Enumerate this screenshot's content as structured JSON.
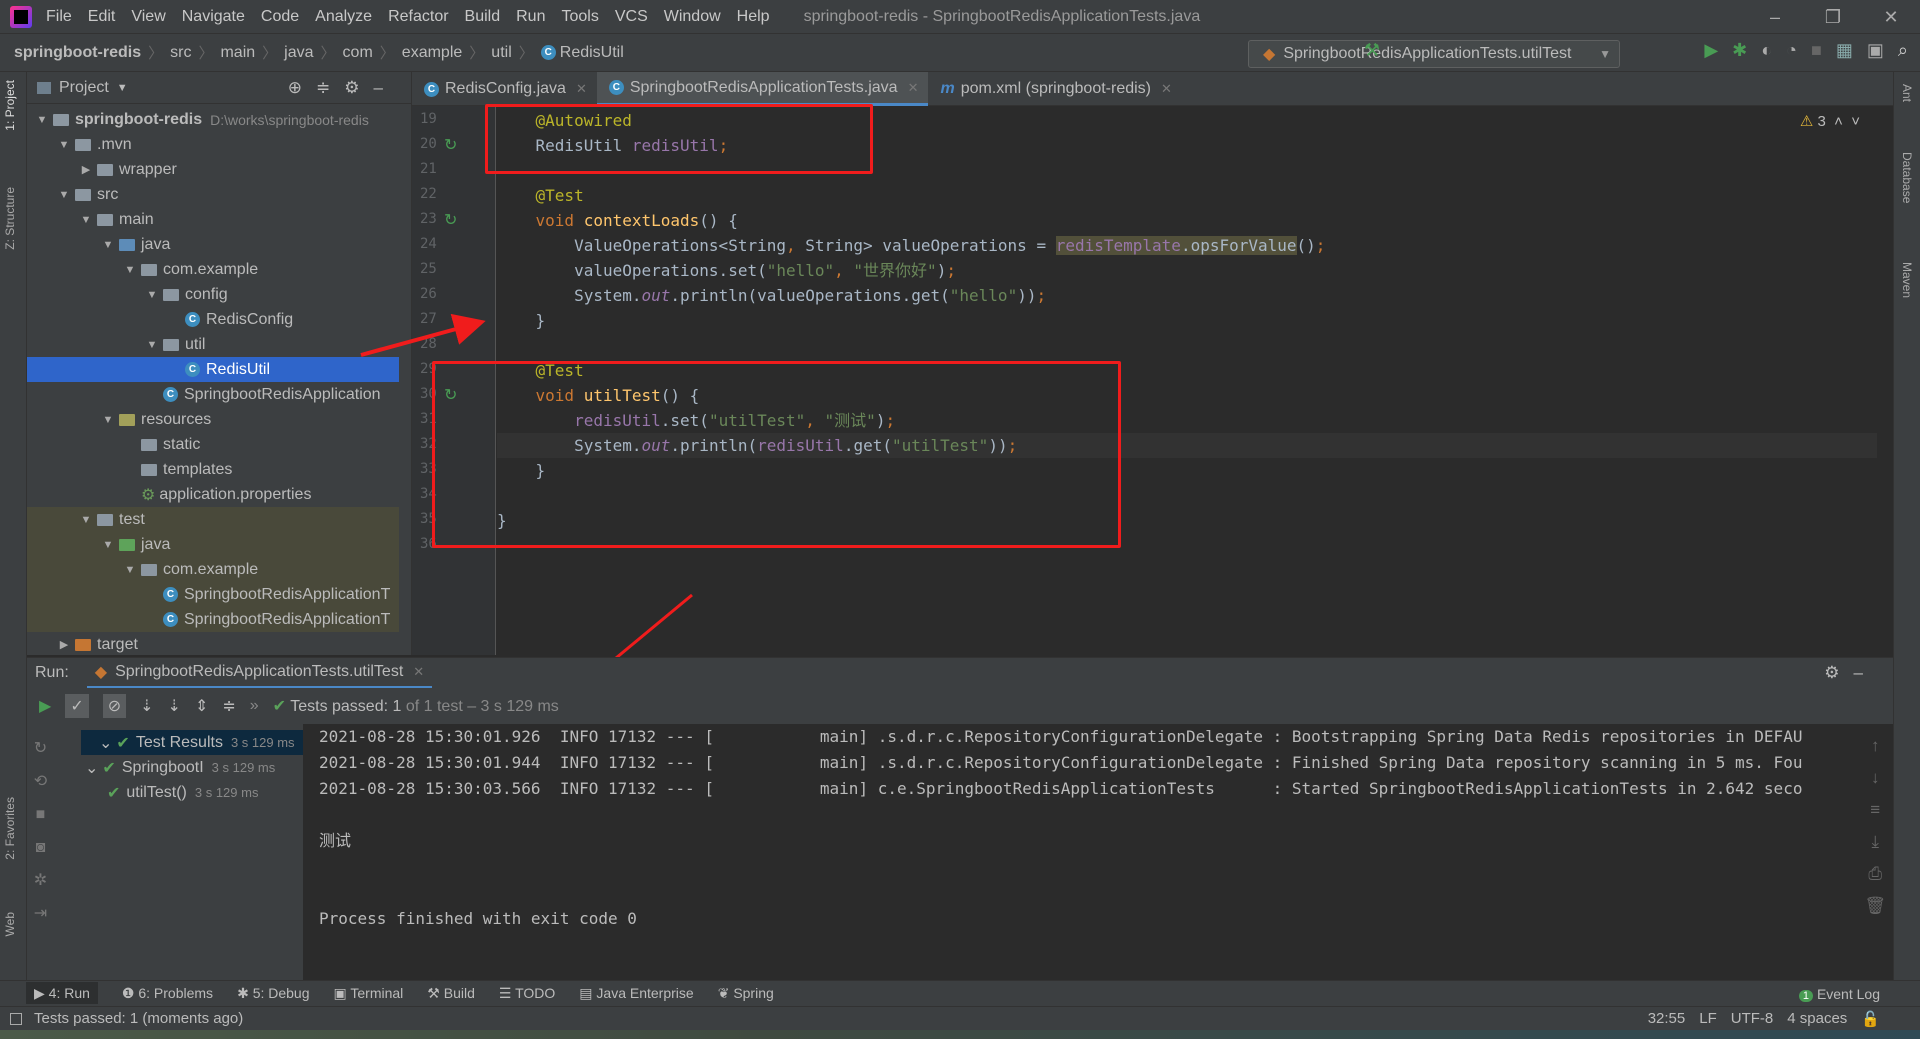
{
  "menubar": {
    "items": [
      "File",
      "Edit",
      "View",
      "Navigate",
      "Code",
      "Analyze",
      "Refactor",
      "Build",
      "Run",
      "Tools",
      "VCS",
      "Window",
      "Help"
    ],
    "title": "springboot-redis - SpringbootRedisApplicationTests.java"
  },
  "breadcrumb": [
    "springboot-redis",
    "src",
    "main",
    "java",
    "com",
    "example",
    "util",
    "RedisUtil"
  ],
  "run_config": "SpringbootRedisApplicationTests.utilTest",
  "left_strip": [
    "1: Project",
    "Z: Structure",
    "2: Favorites",
    "Web"
  ],
  "right_strip": [
    "Ant",
    "Database",
    "Maven"
  ],
  "project": {
    "title": "Project",
    "tree": [
      {
        "label": "springboot-redis",
        "hint": "D:\\works\\springboot-redis",
        "depth": 0,
        "open": true,
        "kind": "module"
      },
      {
        "label": ".mvn",
        "depth": 1,
        "open": true,
        "kind": "folder"
      },
      {
        "label": "wrapper",
        "depth": 2,
        "open": false,
        "kind": "folder"
      },
      {
        "label": "src",
        "depth": 1,
        "open": true,
        "kind": "folder"
      },
      {
        "label": "main",
        "depth": 2,
        "open": true,
        "kind": "folder"
      },
      {
        "label": "java",
        "depth": 3,
        "open": true,
        "kind": "src"
      },
      {
        "label": "com.example",
        "depth": 4,
        "open": true,
        "kind": "folder"
      },
      {
        "label": "config",
        "depth": 5,
        "open": true,
        "kind": "folder"
      },
      {
        "label": "RedisConfig",
        "depth": 6,
        "kind": "class"
      },
      {
        "label": "util",
        "depth": 5,
        "open": true,
        "kind": "folder"
      },
      {
        "label": "RedisUtil",
        "depth": 6,
        "kind": "class",
        "selected": true
      },
      {
        "label": "SpringbootRedisApplication",
        "depth": 5,
        "kind": "class"
      },
      {
        "label": "resources",
        "depth": 3,
        "open": true,
        "kind": "res"
      },
      {
        "label": "static",
        "depth": 4,
        "kind": "folder"
      },
      {
        "label": "templates",
        "depth": 4,
        "kind": "folder"
      },
      {
        "label": "application.properties",
        "depth": 4,
        "kind": "props"
      },
      {
        "label": "test",
        "depth": 2,
        "open": true,
        "kind": "folder",
        "test": true
      },
      {
        "label": "java",
        "depth": 3,
        "open": true,
        "kind": "tst",
        "test": true
      },
      {
        "label": "com.example",
        "depth": 4,
        "open": true,
        "kind": "folder",
        "test": true
      },
      {
        "label": "SpringbootRedisApplicationT",
        "depth": 5,
        "kind": "class",
        "test": true
      },
      {
        "label": "SpringbootRedisApplicationT",
        "depth": 5,
        "kind": "class",
        "test": true
      },
      {
        "label": "target",
        "depth": 1,
        "open": false,
        "kind": "ex"
      }
    ]
  },
  "tabs": [
    {
      "label": "RedisConfig.java",
      "icon": "class"
    },
    {
      "label": "SpringbootRedisApplicationTests.java",
      "icon": "class",
      "active": true
    },
    {
      "label": "pom.xml (springboot-redis)",
      "icon": "maven"
    }
  ],
  "editor": {
    "warnings": "3",
    "current_line": 32,
    "lines": [
      {
        "n": "19",
        "html": "    <span class='ann'>@Autowired</span>"
      },
      {
        "n": "20",
        "html": "    RedisUtil <span class='fld'>redisUtil</span><span class='kw'>;</span>"
      },
      {
        "n": "21",
        "html": ""
      },
      {
        "n": "22",
        "html": "    <span class='ann'>@Test</span>"
      },
      {
        "n": "23",
        "html": "    <span class='kw'>void </span><span class='fn'>contextLoads</span>() {"
      },
      {
        "n": "24",
        "html": "        ValueOperations&lt;String<span class='kw'>, </span>String&gt; valueOperations = <span class='hl'><span class='fld'>redisTemplate</span>.opsForValue</span>()<span class='kw'>;</span>"
      },
      {
        "n": "25",
        "html": "        valueOperations.set(<span class='str'>\"hello\"</span><span class='kw'>, </span><span class='str'>\"世界你好\"</span>)<span class='kw'>;</span>"
      },
      {
        "n": "26",
        "html": "        System.<span class='it'>out</span>.println(valueOperations.get(<span class='str'>\"hello\"</span>))<span class='kw'>;</span>"
      },
      {
        "n": "27",
        "html": "    }"
      },
      {
        "n": "28",
        "html": ""
      },
      {
        "n": "29",
        "html": "    <span class='ann'>@Test</span>"
      },
      {
        "n": "30",
        "html": "    <span class='kw'>void </span><span class='fn'>utilTest</span>() {"
      },
      {
        "n": "31",
        "html": "        <span class='fld'>redisUtil</span>.set(<span class='str'>\"utilTest\"</span><span class='kw'>, </span><span class='str'>\"测试\"</span>)<span class='kw'>;</span>"
      },
      {
        "n": "32",
        "html": "        System.<span class='it'>out</span>.println(<span class='fld'>redisUtil</span>.get(<span class='str'>\"utilTest\"</span>))<span class='kw'>;</span>"
      },
      {
        "n": "33",
        "html": "    }"
      },
      {
        "n": "34",
        "html": ""
      },
      {
        "n": "35",
        "html": "}"
      },
      {
        "n": "36",
        "html": ""
      }
    ]
  },
  "run": {
    "label": "Run:",
    "tab": "SpringbootRedisApplicationTests.utilTest",
    "status_passed": "Tests passed: 1",
    "status_rest": " of 1 test – 3 s 129 ms",
    "tree": [
      {
        "label": "Test Results",
        "time": "3 s 129 ms",
        "depth": 0
      },
      {
        "label": "SpringbootI",
        "time": "3 s 129 ms",
        "depth": 1
      },
      {
        "label": "utilTest()",
        "time": "3 s 129 ms",
        "depth": 2
      }
    ],
    "console": [
      "2021-08-28 15:30:01.926  INFO 17132 --- [           main] .s.d.r.c.RepositoryConfigurationDelegate : Bootstrapping Spring Data Redis repositories in DEFAU",
      "2021-08-28 15:30:01.944  INFO 17132 --- [           main] .s.d.r.c.RepositoryConfigurationDelegate : Finished Spring Data repository scanning in 5 ms. Fou",
      "2021-08-28 15:30:03.566  INFO 17132 --- [           main] c.e.SpringbootRedisApplicationTests      : Started SpringbootRedisApplicationTests in 2.642 seco",
      "",
      "测试",
      "",
      "",
      "Process finished with exit code 0"
    ]
  },
  "toolwindows": [
    "4: Run",
    "6: Problems",
    "5: Debug",
    "Terminal",
    "Build",
    "TODO",
    "Java Enterprise",
    "Spring"
  ],
  "event_log": {
    "label": "Event Log",
    "count": "1"
  },
  "status": {
    "message": "Tests passed: 1 (moments ago)",
    "position": "32:55",
    "line_sep": "LF",
    "encoding": "UTF-8",
    "indent": "4 spaces"
  },
  "colors": {
    "annotation": "#f01c1c",
    "accent": "#2f65ca",
    "pass": "#5aa25a"
  }
}
